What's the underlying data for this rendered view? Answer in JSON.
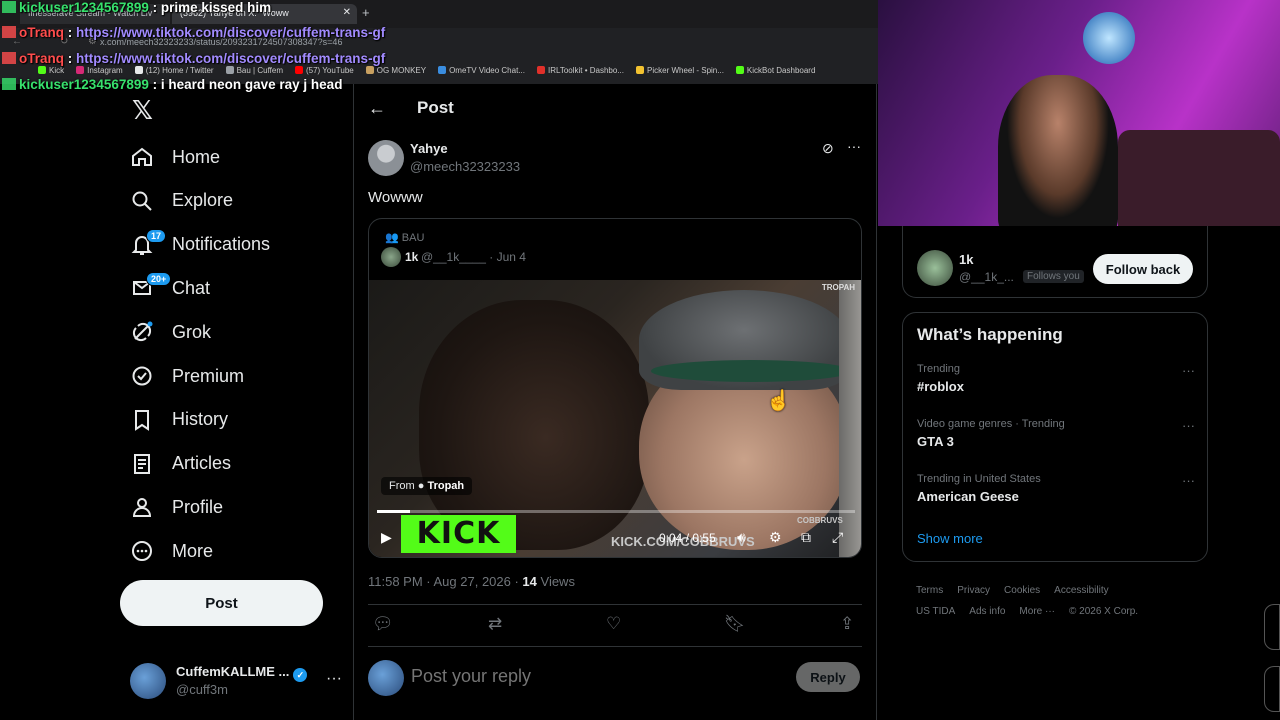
{
  "browser": {
    "tabs": [
      {
        "label": "finessefave Stream - Watch Liv"
      },
      {
        "label": "(3962) Yahye on X: \"Woww"
      }
    ],
    "new_tab": "+",
    "address": "x.com/meech32323233/status/2093231724507308347?s=46",
    "bookmarks": [
      {
        "label": "Kick",
        "color": "#53fc18"
      },
      {
        "label": "Instagram",
        "color": "#d62976"
      },
      {
        "label": "(12) Home / Twitter",
        "color": "#e7e9ea"
      },
      {
        "label": "Bau | Cuffem",
        "color": "#9aa0a6"
      },
      {
        "label": "(57) YouTube",
        "color": "#ff0000"
      },
      {
        "label": "OG MONKEY",
        "color": "#c8a060"
      },
      {
        "label": "OmeTV Video Chat...",
        "color": "#3a8de0"
      },
      {
        "label": "IRLToolkit • Dashbo...",
        "color": "#e0302a"
      },
      {
        "label": "Picker Wheel - Spin...",
        "color": "#f2c230"
      },
      {
        "label": "KickBot Dashboard",
        "color": "#53fc18"
      }
    ]
  },
  "chat": [
    {
      "user": "kickuser1234567899",
      "user_color": "#37e26d",
      "sep": " : ",
      "text": "prime kissed him",
      "is_link": false
    },
    {
      "user": "oTranq",
      "user_color": "#ff4d4d",
      "sep": " : ",
      "text": "https://www.tiktok.com/discover/cuffem-trans-gf",
      "is_link": true
    },
    {
      "user": "oTranq",
      "user_color": "#ff4d4d",
      "sep": " : ",
      "text": "https://www.tiktok.com/discover/cuffem-trans-gf",
      "is_link": true
    },
    {
      "user": "kickuser1234567899",
      "user_color": "#37e26d",
      "sep": " : ",
      "text": "i heard neon gave ray j head",
      "is_link": false
    }
  ],
  "nav": {
    "logo": "𝕏",
    "items": [
      {
        "label": "Home",
        "icon": "home-icon",
        "badge": ""
      },
      {
        "label": "Explore",
        "icon": "search-icon",
        "badge": ""
      },
      {
        "label": "Notifications",
        "icon": "bell-icon",
        "badge": "17"
      },
      {
        "label": "Chat",
        "icon": "mail-icon",
        "badge": "20+"
      },
      {
        "label": "Grok",
        "icon": "grok-icon",
        "badge": ""
      },
      {
        "label": "Premium",
        "icon": "premium-icon",
        "badge": ""
      },
      {
        "label": "History",
        "icon": "bookmark-icon",
        "badge": ""
      },
      {
        "label": "Articles",
        "icon": "articles-icon",
        "badge": ""
      },
      {
        "label": "Profile",
        "icon": "profile-icon",
        "badge": ""
      },
      {
        "label": "More",
        "icon": "more-icon",
        "badge": ""
      }
    ],
    "post_button": "Post",
    "account": {
      "name": "CuffemKALLME ...",
      "handle": "@cuff3m",
      "more": "···"
    }
  },
  "main": {
    "back": "←",
    "title": "Post",
    "post": {
      "author": "Yahye",
      "handle": "@meech32323233",
      "text": "Wowww",
      "timestamp": "11:58 PM · Aug 27, 2026 · ",
      "views_count": "14",
      "views_label": " Views"
    },
    "quote": {
      "community": "BAU",
      "author": "1k",
      "meta": "@__1k____ · Jun 4",
      "video": {
        "watermark": "TROPAH",
        "from_label": "From",
        "from_source": "Tropah",
        "kick_logo": "KICK",
        "kick_url": "KICK.COM/COBBRUVS",
        "cobb": "COBBRUVS",
        "time": "0:04 / 0:55",
        "progress": 0.07
      }
    },
    "reply_placeholder": "Post your reply",
    "reply_button": "Reply"
  },
  "right": {
    "follow": {
      "name": "1k",
      "handle": "@__1k_...",
      "tag": "Follows you",
      "button": "Follow back"
    },
    "happening_title": "What’s happening",
    "trends": [
      {
        "context": "Trending",
        "name": "#roblox"
      },
      {
        "context": "Video game genres · Trending",
        "name": "GTA 3"
      },
      {
        "context": "Trending in United States",
        "name": "American Geese"
      }
    ],
    "show_more": "Show more",
    "footer": [
      "Terms",
      "Privacy",
      "Cookies",
      "Accessibility",
      "US TIDA",
      "Ads info",
      "More ···",
      "© 2026 X Corp."
    ]
  }
}
